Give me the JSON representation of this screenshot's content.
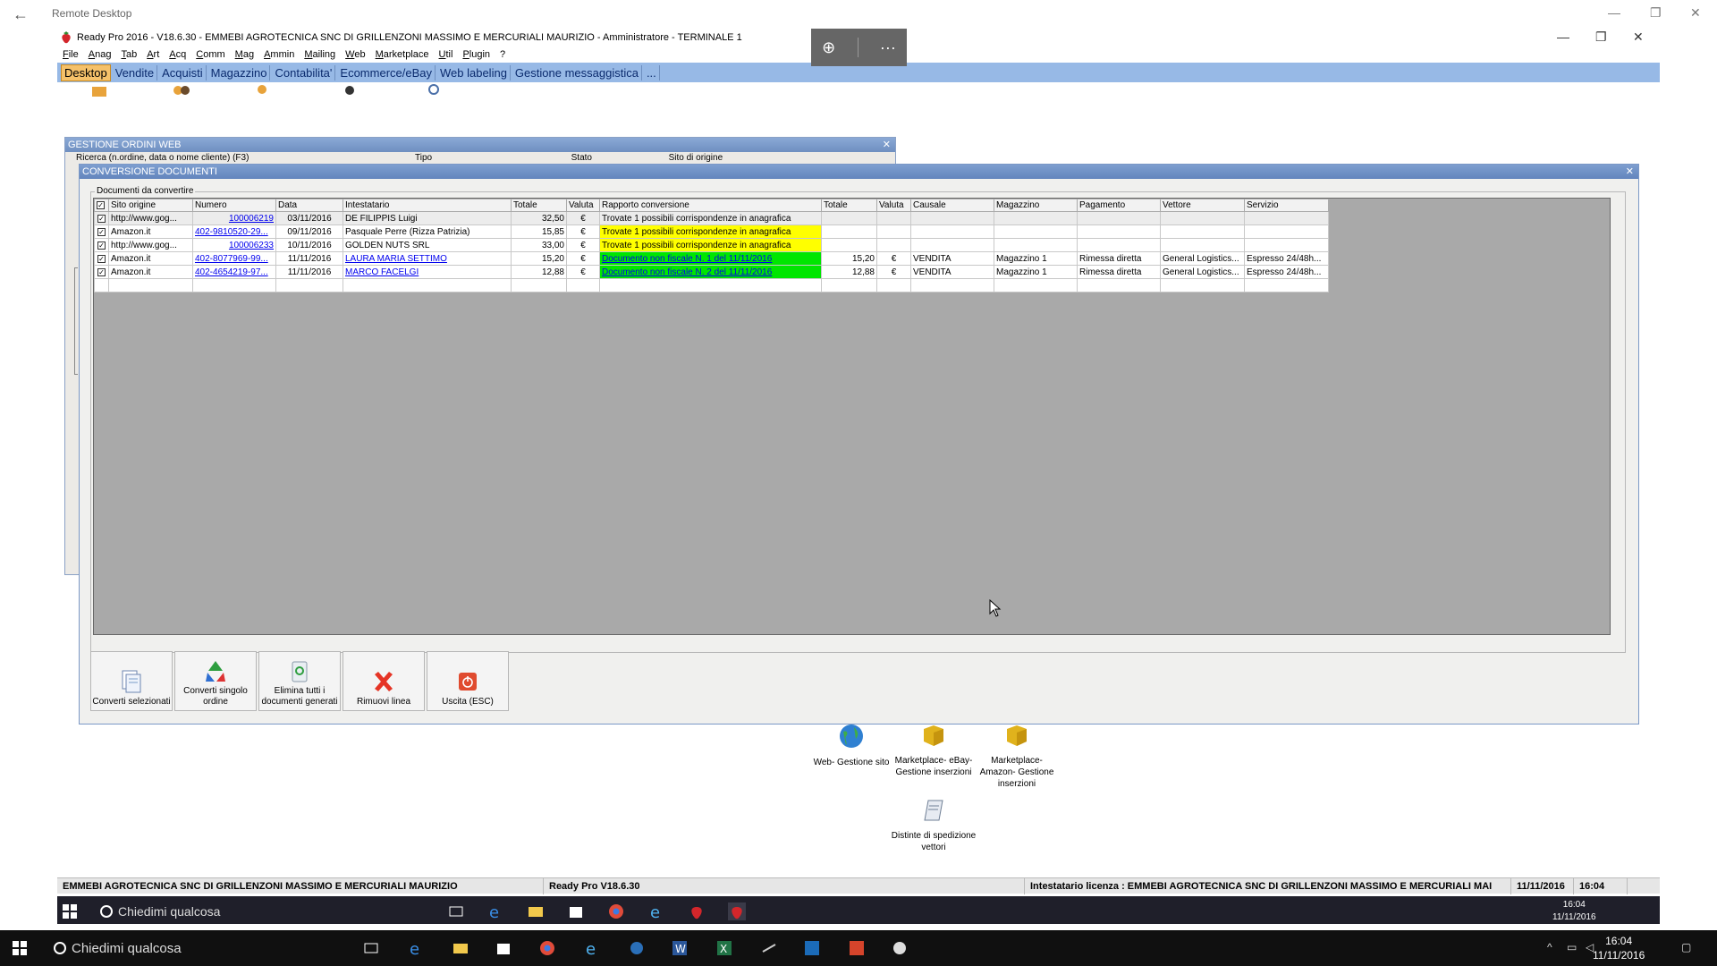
{
  "remote": {
    "title": "Remote Desktop",
    "back_glyph": "←",
    "min_glyph": "—",
    "max_glyph": "❐",
    "close_glyph": "✕"
  },
  "app": {
    "title": "Ready Pro 2016 - V18.6.30 - EMMEBI AGROTECNICA SNC DI GRILLENZONI MASSIMO E MERCURIALI MAURIZIO - Amministratore - TERMINALE 1",
    "min_glyph": "—",
    "max_glyph": "❐",
    "close_glyph": "✕"
  },
  "zoom_overlay": {
    "zoom_glyph": "⊕",
    "more_glyph": "···"
  },
  "menu": [
    "File",
    "Anag",
    "Tab",
    "Art",
    "Acq",
    "Comm",
    "Mag",
    "Ammin",
    "Mailing",
    "Web",
    "Marketplace",
    "Util",
    "Plugin",
    "?"
  ],
  "tabs": [
    {
      "label": "Desktop",
      "active": true
    },
    {
      "label": "Vendite"
    },
    {
      "label": "Acquisti"
    },
    {
      "label": "Magazzino"
    },
    {
      "label": "Contabilita'"
    },
    {
      "label": "Ecommerce/eBay"
    },
    {
      "label": "Web labeling"
    },
    {
      "label": "Gestione messaggistica"
    },
    {
      "label": "..."
    }
  ],
  "ordini_window": {
    "title": "GESTIONE ORDINI WEB",
    "search_label": "Ricerca (n.ordine, data o nome cliente) (F3)",
    "tipo_label": "Tipo",
    "stato_label": "Stato",
    "sito_label": "Sito di origine",
    "close_glyph": "✕"
  },
  "conv_window": {
    "title": "CONVERSIONE DOCUMENTI",
    "group_label": "Documenti da convertire",
    "close_glyph": "✕",
    "columns": [
      "Sito origine",
      "Numero",
      "Data",
      "Intestatario",
      "Totale",
      "Valuta",
      "Rapporto conversione",
      "Totale",
      "Valuta",
      "Causale",
      "Magazzino",
      "Pagamento",
      "Vettore",
      "Servizio"
    ],
    "rows": [
      {
        "sito": "http://www.gog...",
        "numero": "100006219",
        "data": "03/11/2016",
        "intestatario": "DE FILIPPIS Luigi",
        "totale": "32,50",
        "valuta": "€",
        "rapporto": "Trovate 1 possibili corrispondenze in anagrafica",
        "tot2": "",
        "val2": "",
        "causale": "",
        "magazzino": "",
        "pagamento": "",
        "vettore": "",
        "servizio": ""
      },
      {
        "sito": "Amazon.it",
        "numero": "402-9810520-29...",
        "data": "09/11/2016",
        "intestatario": "Pasquale Perre (Rizza Patrizia)",
        "totale": "15,85",
        "valuta": "€",
        "rapporto": "Trovate 1 possibili corrispondenze in anagrafica",
        "tot2": "",
        "val2": "",
        "causale": "",
        "magazzino": "",
        "pagamento": "",
        "vettore": "",
        "servizio": ""
      },
      {
        "sito": "http://www.gog...",
        "numero": "100006233",
        "data": "10/11/2016",
        "intestatario": "GOLDEN NUTS SRL",
        "totale": "33,00",
        "valuta": "€",
        "rapporto": "Trovate 1 possibili corrispondenze in anagrafica",
        "tot2": "",
        "val2": "",
        "causale": "",
        "magazzino": "",
        "pagamento": "",
        "vettore": "",
        "servizio": ""
      },
      {
        "sito": "Amazon.it",
        "numero": "402-8077969-99...",
        "data": "11/11/2016",
        "intestatario": "LAURA MARIA SETTIMO",
        "totale": "15,20",
        "valuta": "€",
        "rapporto": "Documento non fiscale N. 1 del 11/11/2016",
        "tot2": "15,20",
        "val2": "€",
        "causale": "VENDITA",
        "magazzino": "Magazzino 1",
        "pagamento": "Rimessa diretta",
        "vettore": "General Logistics...",
        "servizio": "Espresso 24/48h..."
      },
      {
        "sito": "Amazon.it",
        "numero": "402-4654219-97...",
        "data": "11/11/2016",
        "intestatario": "MARCO FACELGI",
        "totale": "12,88",
        "valuta": "€",
        "rapporto": "Documento non fiscale N. 2 del 11/11/2016",
        "tot2": "12,88",
        "val2": "€",
        "causale": "VENDITA",
        "magazzino": "Magazzino 1",
        "pagamento": "Rimessa diretta",
        "vettore": "General Logistics...",
        "servizio": "Espresso 24/48h..."
      }
    ],
    "buttons": [
      {
        "label": "Converti selezionati"
      },
      {
        "label": "Converti singolo ordine"
      },
      {
        "label": "Elimina tutti i documenti generati"
      },
      {
        "label": "Rimuovi linea"
      },
      {
        "label": "Uscita (ESC)"
      }
    ]
  },
  "desktop_icons": [
    {
      "label": "Web- Gestione sito",
      "icon": "globe-icon"
    },
    {
      "label": "Marketplace- eBay- Gestione inserzioni",
      "icon": "box-icon"
    },
    {
      "label": "Marketplace- Amazon- Gestione inserzioni",
      "icon": "box-icon"
    },
    {
      "label": "Distinte di spedizione vettori",
      "icon": "scroll-icon"
    }
  ],
  "statusbar": {
    "company": "EMMEBI AGROTECNICA SNC DI GRILLENZONI MASSIMO E MERCURIALI MAURIZIO",
    "version": "Ready Pro V18.6.30",
    "license": "Intestatario licenza : EMMEBI AGROTECNICA SNC DI GRILLENZONI MASSIMO E MERCURIALI MAI",
    "date": "11/11/2016",
    "time": "16:04"
  },
  "inner_taskbar": {
    "search_placeholder": "Chiedimi qualcosa",
    "time": "16:04",
    "date": "11/11/2016"
  },
  "outer_taskbar": {
    "search_placeholder": "Chiedimi qualcosa",
    "time": "16:04",
    "date": "11/11/2016"
  },
  "colors": {
    "tab_bar": "#97b9e6",
    "title_gradient": "#6f8fc0",
    "yellow": "#ffff00",
    "green": "#00e600"
  }
}
